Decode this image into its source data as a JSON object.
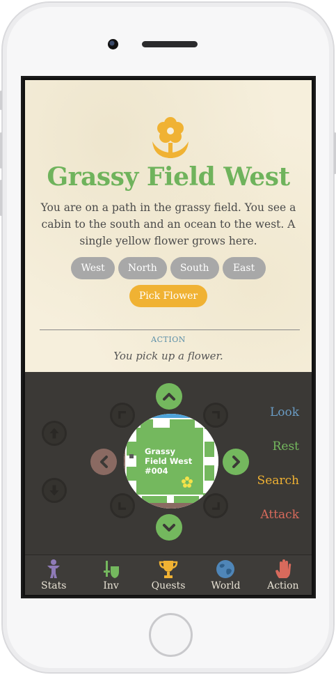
{
  "location": {
    "title": "Grassy Field West",
    "description": "You are on a path in the grassy field. You see a cabin to the south and an ocean to the west. A single yellow flower grows here.",
    "icon": "flower-icon"
  },
  "directions": [
    "West",
    "North",
    "South",
    "East"
  ],
  "action_buttons": [
    "Pick Flower"
  ],
  "action_log": {
    "heading": "ACTION",
    "message": "You pick up a flower."
  },
  "map": {
    "label_line1": "Grassy",
    "label_line2": "Field West",
    "label_line3": "#004"
  },
  "side_actions": {
    "look": "Look",
    "rest": "Rest",
    "search": "Search",
    "attack": "Attack"
  },
  "tabs": [
    "Stats",
    "Inv",
    "Quests",
    "World",
    "Action"
  ],
  "colors": {
    "accent_green": "#6fb35c",
    "accent_orange": "#f0b233",
    "look": "#6a9cc4",
    "rest": "#74b85e",
    "search": "#f0b233",
    "attack": "#d86a5c",
    "panel_bg": "#3b3936"
  }
}
